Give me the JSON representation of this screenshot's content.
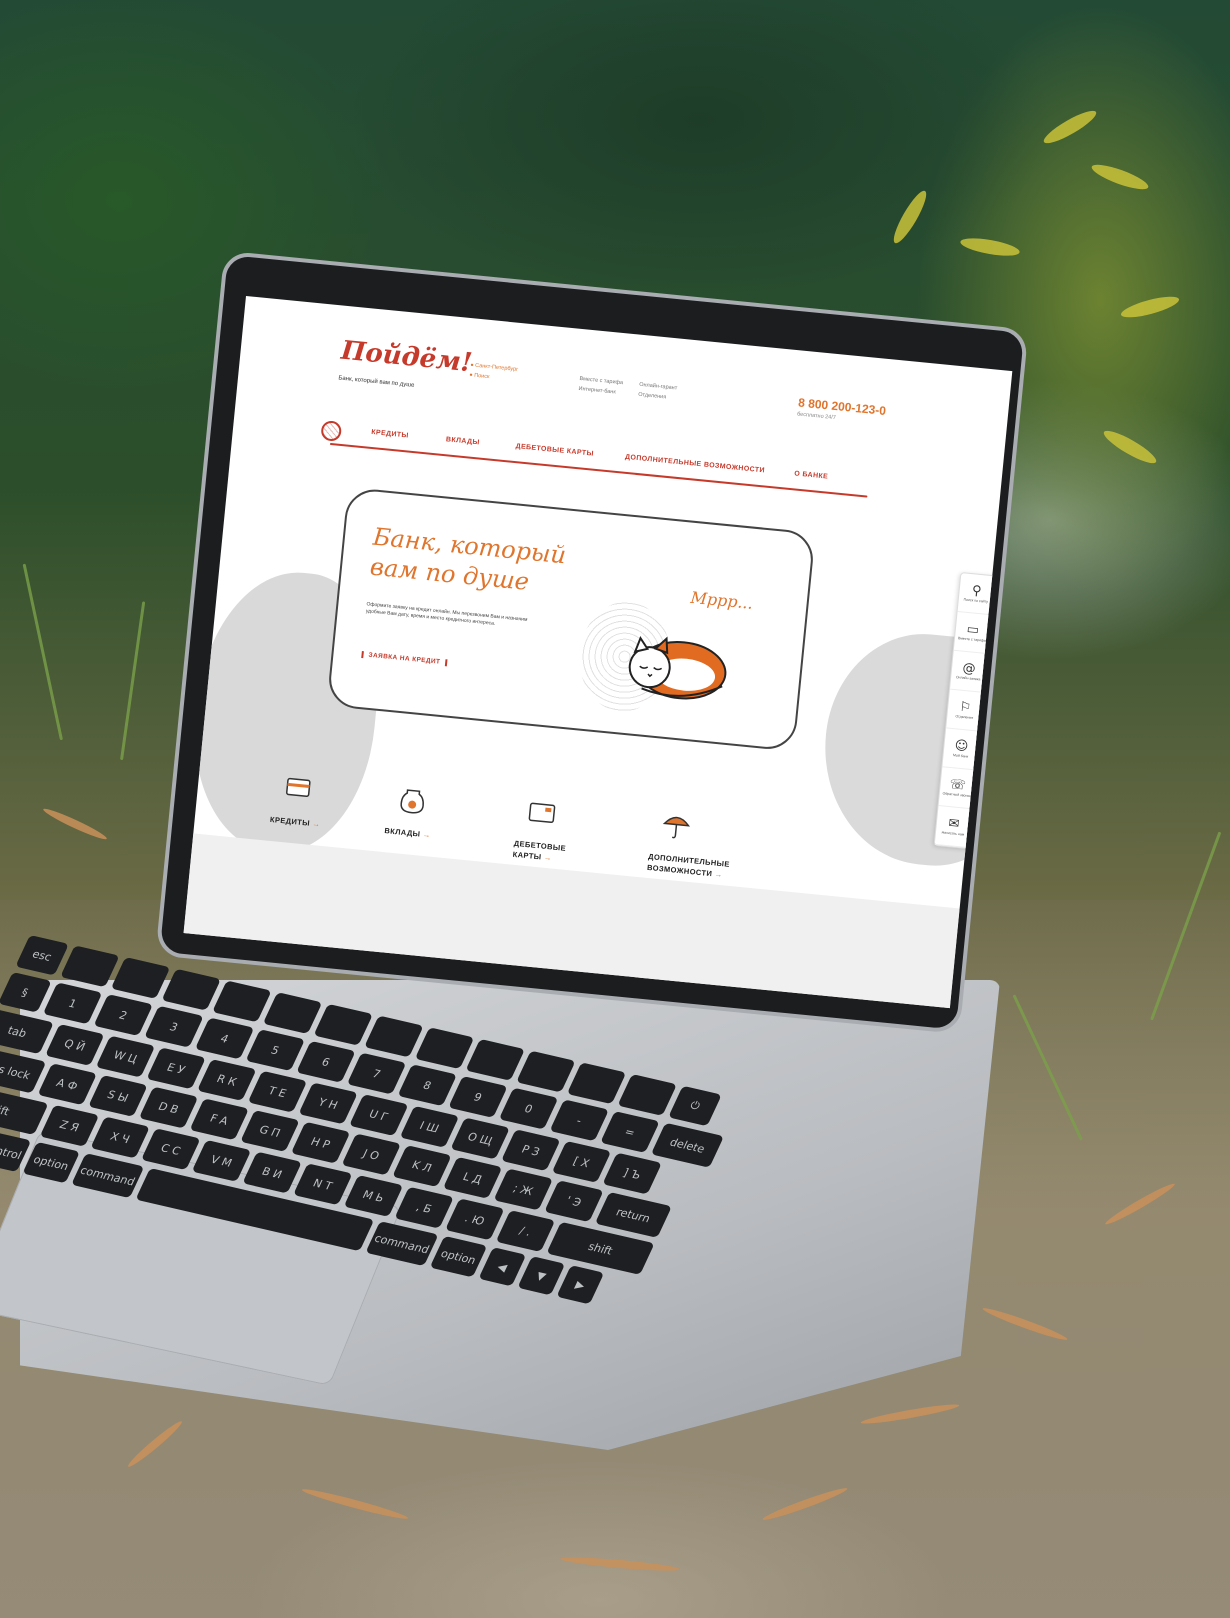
{
  "site": {
    "logo": "Пойдём!",
    "tagline": "Банк, который вам по душе",
    "city": "Санкт-Петербург",
    "search": "Поиск",
    "links_col1": [
      "Вместе с тарифа",
      "Интернет-банк"
    ],
    "links_col2": [
      "Онлайн-гарант",
      "Отделения"
    ],
    "phone": "8 800 200-123-0",
    "phone_sub": "бесплатно 24/7"
  },
  "nav": {
    "items": [
      "КРЕДИТЫ",
      "ВКЛАДЫ",
      "ДЕБЕТОВЫЕ КАРТЫ",
      "ДОПОЛНИТЕЛЬНЫЕ ВОЗМОЖНОСТИ",
      "О БАНКЕ"
    ]
  },
  "hero": {
    "title": "Банк, который вам по душе",
    "text": "Оформите заявку на кредит онлайн. Мы перезвоним Вам и назначим удобные Вам дату, время и место кредитного интереса.",
    "cta": "ЗАЯВКА НА КРЕДИТ",
    "cat_caption": "Мррр..."
  },
  "features": [
    {
      "label": "КРЕДИТЫ",
      "arrow": "→"
    },
    {
      "label": "ВКЛАДЫ",
      "arrow": "→"
    },
    {
      "label": "ДЕБЕТОВЫЕ КАРТЫ",
      "arrow": "→"
    },
    {
      "label": "ДОПОЛНИТЕЛЬНЫЕ ВОЗМОЖНОСТИ",
      "arrow": "→"
    }
  ],
  "sidebar": [
    {
      "icon": "search-icon",
      "label": "Поиск по сайту"
    },
    {
      "icon": "wallet-icon",
      "label": "Вместе с тарифа"
    },
    {
      "icon": "at-icon",
      "label": "Онлайн-заявка"
    },
    {
      "icon": "pin-icon",
      "label": "Отделения"
    },
    {
      "icon": "user-icon",
      "label": "Мой банк"
    },
    {
      "icon": "phone-icon",
      "label": "Обратный звонок"
    },
    {
      "icon": "mail-icon",
      "label": "Написать нам"
    }
  ],
  "colors": {
    "brand_red": "#c63a2b",
    "brand_orange": "#e0752d"
  }
}
